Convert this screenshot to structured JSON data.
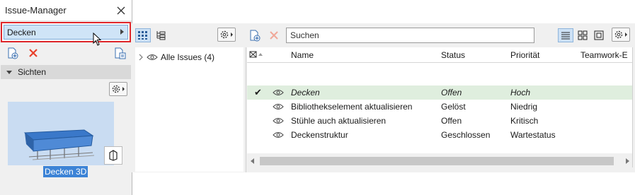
{
  "palette": {
    "title": "Issue-Manager",
    "dropdown_value": "Decken",
    "section_label": "Sichten",
    "thumbnail_label": "Decken 3D"
  },
  "main": {
    "search_placeholder": "Suchen",
    "tree_item": "Alle Issues (4)",
    "columns": [
      "Name",
      "Status",
      "Priorität",
      "Teamwork-E"
    ],
    "rows": [
      {
        "name": "Decken",
        "status": "Offen",
        "priority": "Hoch",
        "checked": true
      },
      {
        "name": "Bibliothekselement aktualisieren",
        "status": "Gelöst",
        "priority": "Niedrig",
        "checked": false
      },
      {
        "name": "Stühle auch aktualisieren",
        "status": "Offen",
        "priority": "Kritisch",
        "checked": false
      },
      {
        "name": "Deckenstruktur",
        "status": "Geschlossen",
        "priority": "Wartestatus",
        "checked": false
      }
    ],
    "checkmark": "✔"
  },
  "colors": {
    "highlight_red": "#e0262a",
    "selection_green": "#dfeede",
    "accent_blue": "#3c83d6",
    "delete_red": "#e8402a"
  },
  "icons": [
    "close-icon",
    "cursor-icon",
    "new-issue-icon",
    "delete-icon",
    "export-icon",
    "gear-icon",
    "view-icon",
    "eye-icon",
    "chevron-right-icon",
    "grid-view-icon",
    "tree-view-icon",
    "list-view-icon",
    "tile-view-icon",
    "single-view-icon",
    "sort-icon"
  ]
}
